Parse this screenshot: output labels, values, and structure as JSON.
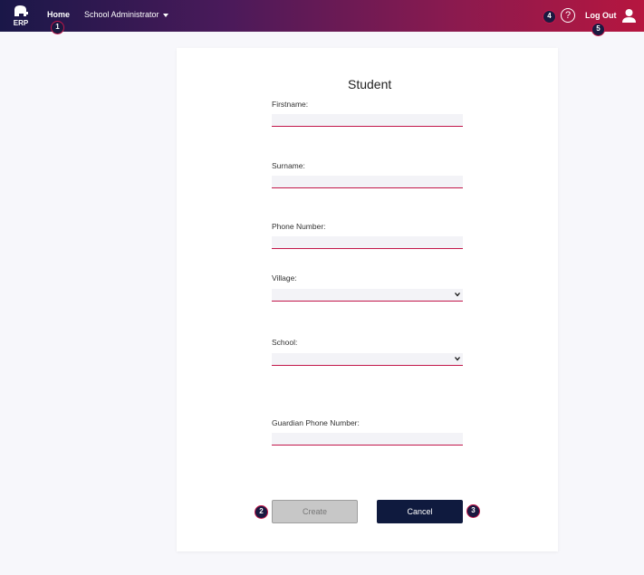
{
  "header": {
    "logo_text": "ERP",
    "nav_home": "Home",
    "nav_admin": "School Administrator",
    "logout": "Log Out",
    "help_icon": "question-circle-icon",
    "user_icon": "user-icon"
  },
  "badges": [
    "1",
    "2",
    "3",
    "4",
    "5"
  ],
  "form": {
    "title": "Student",
    "firstname_label": "Firstname:",
    "surname_label": "Surname:",
    "phone_label": "Phone Number:",
    "village_label": "Village:",
    "school_label": "School:",
    "guardian_label": "Guardian Phone Number:",
    "create_label": "Create",
    "cancel_label": "Cancel"
  },
  "colors": {
    "accent": "#c2174a",
    "header_start": "#1a1748",
    "header_end": "#b6163f",
    "cancel_bg": "#0f1a3e",
    "create_disabled": "#c7c7c7"
  }
}
